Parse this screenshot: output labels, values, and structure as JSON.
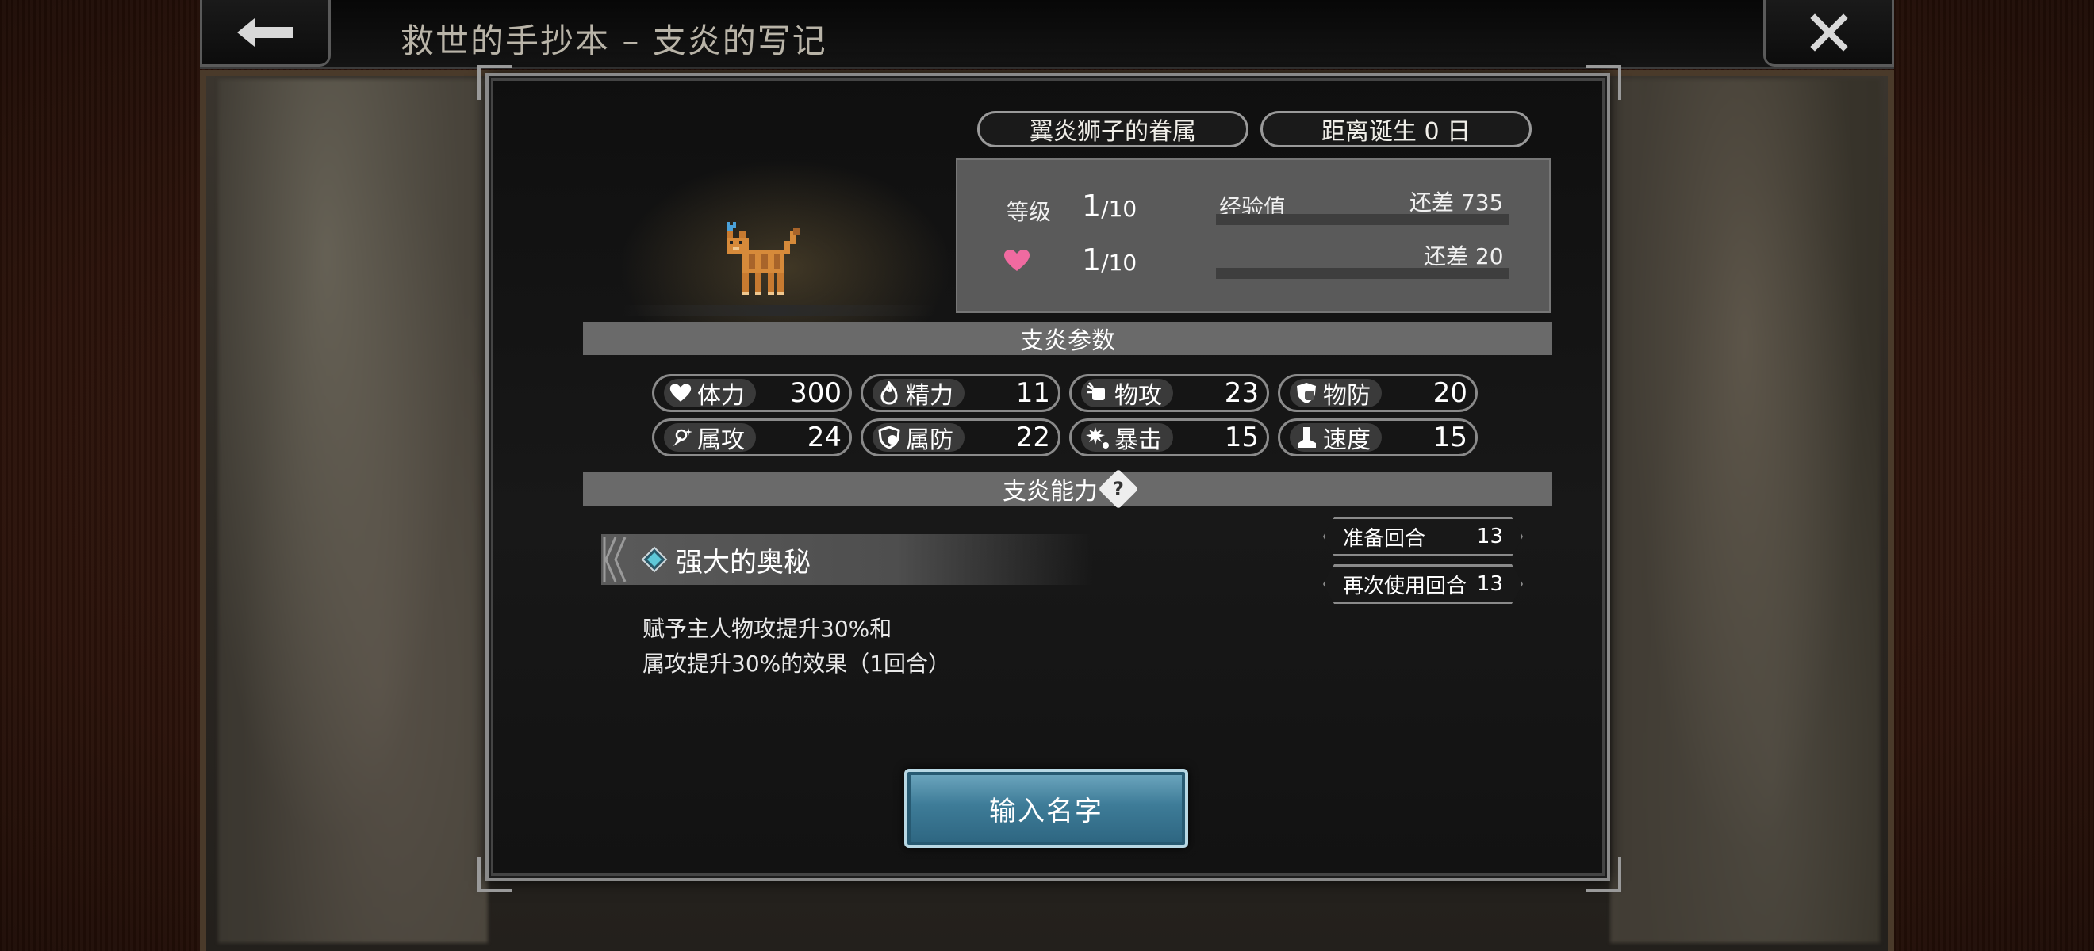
{
  "header": {
    "title": "救世的手抄本 – 支炎的写记"
  },
  "pet": {
    "origin": "翼炎狮子的眷属",
    "birth": "距离诞生 0 日",
    "level_label": "等级",
    "level_value": "1",
    "level_max": "/10",
    "exp_label": "经验值",
    "exp_remaining": "还差 735",
    "affection_value": "1",
    "affection_max": "/10",
    "affection_remaining": "还差 20",
    "exp_progress": 0.0,
    "affection_progress": 0.0
  },
  "params": {
    "title": "支炎参数",
    "stats": [
      {
        "name": "体力",
        "value": "300",
        "icon": "heart-icon"
      },
      {
        "name": "精力",
        "value": "11",
        "icon": "flame-icon"
      },
      {
        "name": "物攻",
        "value": "23",
        "icon": "fist-icon"
      },
      {
        "name": "物防",
        "value": "20",
        "icon": "shield-icon"
      },
      {
        "name": "属攻",
        "value": "24",
        "icon": "magic-hand-icon"
      },
      {
        "name": "属防",
        "value": "22",
        "icon": "magic-shield-icon"
      },
      {
        "name": "暴击",
        "value": "15",
        "icon": "burst-icon"
      },
      {
        "name": "速度",
        "value": "15",
        "icon": "boot-icon"
      }
    ]
  },
  "ability": {
    "title": "支炎能力",
    "skill_name": "强大的奥秘",
    "desc_line1": "赋予主人物攻提升30%和",
    "desc_line2": "属攻提升30%的效果（1回合）",
    "prep_label": "准备回合",
    "prep_value": "13",
    "reuse_label": "再次使用回合",
    "reuse_value": "13"
  },
  "buttons": {
    "name_input": "输入名字"
  },
  "colors": {
    "accent_button": "#3e7c98",
    "heart": "#f06aa0",
    "diamond": "#5ec8d8"
  }
}
